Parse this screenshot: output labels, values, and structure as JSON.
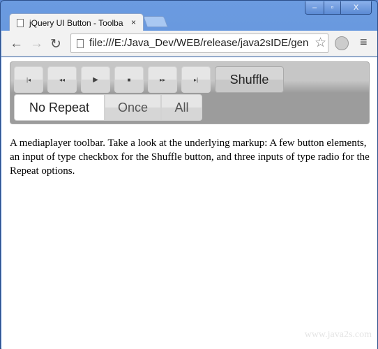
{
  "window": {
    "minimize": "‒",
    "maximize": "▫",
    "close": "X"
  },
  "tab": {
    "title": "jQuery UI Button - Toolba",
    "close": "×"
  },
  "address": {
    "url": "file:///E:/Java_Dev/WEB/release/java2sIDE/gen"
  },
  "toolbar": {
    "buttons": [
      {
        "name": "beginning",
        "glyph": "|◂"
      },
      {
        "name": "rewind",
        "glyph": "◂◂"
      },
      {
        "name": "play",
        "glyph": "▶"
      },
      {
        "name": "stop",
        "glyph": "■"
      },
      {
        "name": "fast-forward",
        "glyph": "▸▸"
      },
      {
        "name": "end",
        "glyph": "▸|"
      }
    ],
    "shuffle": "Shuffle",
    "repeat": [
      {
        "label": "No Repeat",
        "selected": true
      },
      {
        "label": "Once",
        "selected": false
      },
      {
        "label": "All",
        "selected": false
      }
    ]
  },
  "description": "A mediaplayer toolbar. Take a look at the underlying markup: A few button elements, an input of type checkbox for the Shuffle button, and three inputs of type radio for the Repeat options.",
  "watermark": "www.java2s.com"
}
